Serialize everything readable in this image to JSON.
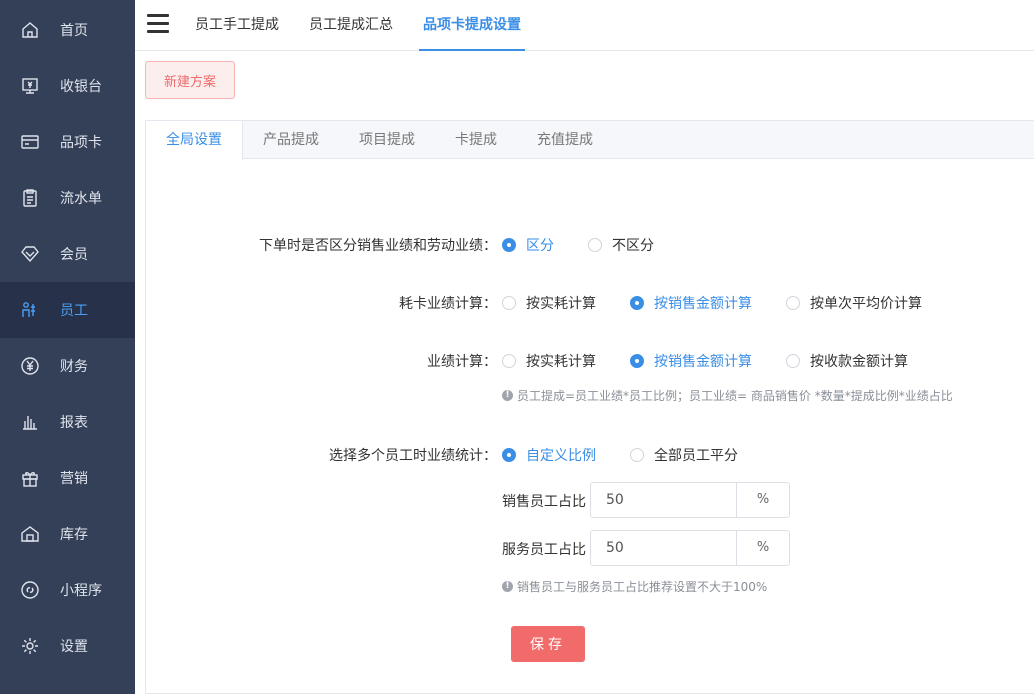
{
  "sidebar": {
    "items": [
      {
        "label": "首页",
        "icon": "home-icon"
      },
      {
        "label": "收银台",
        "icon": "cashier-icon"
      },
      {
        "label": "品项卡",
        "icon": "card-icon"
      },
      {
        "label": "流水单",
        "icon": "clipboard-icon"
      },
      {
        "label": "会员",
        "icon": "diamond-icon"
      },
      {
        "label": "员工",
        "icon": "staff-icon",
        "active": true
      },
      {
        "label": "财务",
        "icon": "yen-icon"
      },
      {
        "label": "报表",
        "icon": "bar-chart-icon"
      },
      {
        "label": "营销",
        "icon": "gift-icon"
      },
      {
        "label": "库存",
        "icon": "warehouse-icon"
      },
      {
        "label": "小程序",
        "icon": "link-icon"
      },
      {
        "label": "设置",
        "icon": "gear-icon"
      }
    ],
    "active_color": "#4a9ff5"
  },
  "header": {
    "tabs": [
      {
        "label": "员工手工提成"
      },
      {
        "label": "员工提成汇总"
      },
      {
        "label": "品项卡提成设置",
        "active": true
      }
    ]
  },
  "toolbar": {
    "new_plan_label": "新建方案"
  },
  "subtabs": [
    {
      "label": "全局设置",
      "active": true
    },
    {
      "label": "产品提成"
    },
    {
      "label": "项目提成"
    },
    {
      "label": "卡提成"
    },
    {
      "label": "充值提成"
    }
  ],
  "form": {
    "distinguish": {
      "label": "下单时是否区分销售业绩和劳动业绩：",
      "options": [
        "区分",
        "不区分"
      ],
      "selected": 0
    },
    "card_consume": {
      "label": "耗卡业绩计算：",
      "options": [
        "按实耗计算",
        "按销售金额计算",
        "按单次平均价计算"
      ],
      "selected": 1
    },
    "performance": {
      "label": "业绩计算：",
      "options": [
        "按实耗计算",
        "按销售金额计算",
        "按收款金额计算"
      ],
      "selected": 1,
      "hint": "员工提成=员工业绩*员工比例；员工业绩= 商品销售价 *数量*提成比例*业绩占比"
    },
    "multi_staff": {
      "label": "选择多个员工时业绩统计：",
      "options": [
        "自定义比例",
        "全部员工平分"
      ],
      "selected": 0
    },
    "sales_ratio": {
      "label": "销售员工占比",
      "value": "50",
      "suffix": "%"
    },
    "service_ratio": {
      "label": "服务员工占比",
      "value": "50",
      "suffix": "%"
    },
    "ratio_hint": "销售员工与服务员工占比推荐设置不大于100%",
    "save_label": "保存"
  },
  "colors": {
    "accent": "#3a8ee6",
    "danger": "#f26b6b",
    "sidebar_bg": "#344058"
  }
}
